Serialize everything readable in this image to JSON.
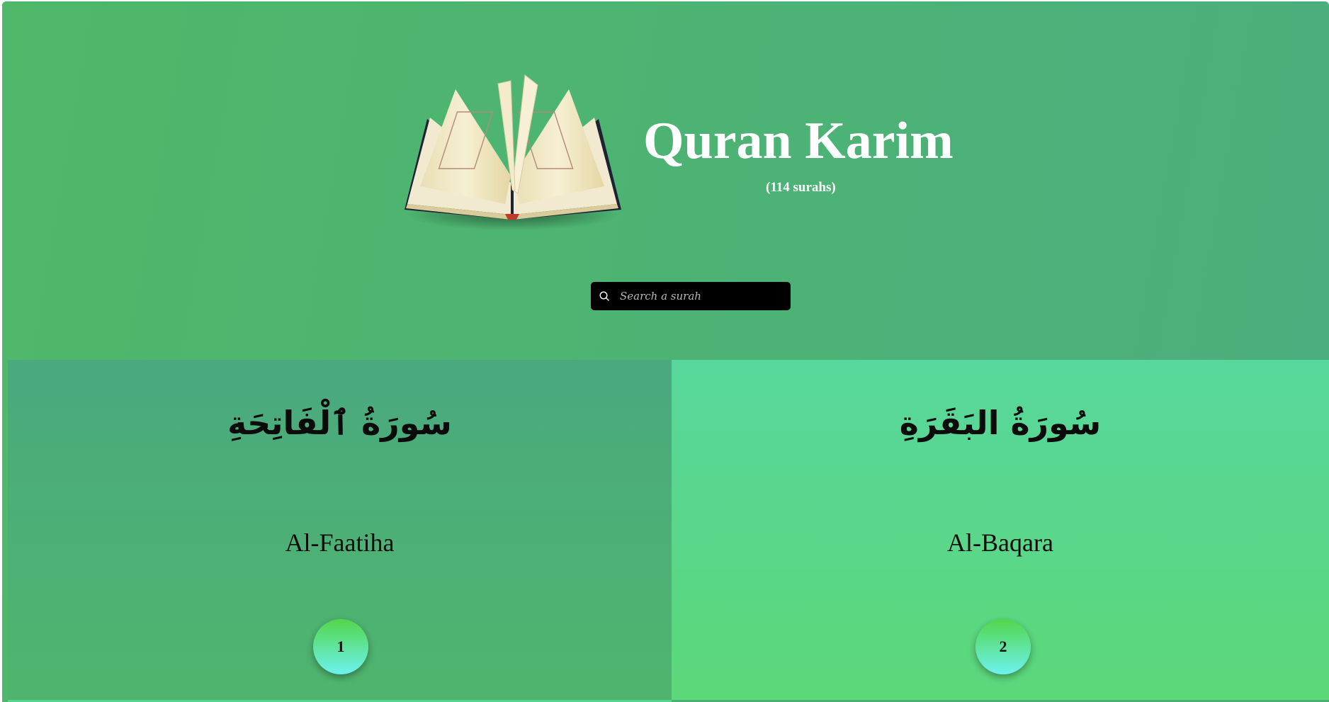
{
  "header": {
    "title": "Quran Karim",
    "subtitle": "(114 surahs)",
    "logo": "open-quran-book-image"
  },
  "search": {
    "placeholder": "Search a surah",
    "value": "",
    "icon": "search-icon"
  },
  "surahs": [
    {
      "arabic": "سُورَةُ ٱلْفَاتِحَةِ",
      "name": "Al-Faatiha",
      "number": "1"
    },
    {
      "arabic": "سُورَةُ البَقَرَةِ",
      "name": "Al-Baqara",
      "number": "2"
    }
  ],
  "colors": {
    "background_green": "#50b96a",
    "card_dark": "#4aa97f",
    "card_light": "#57d79c",
    "search_bg": "#000000",
    "badge_top": "#52d64a",
    "badge_bottom": "#6df2f0"
  }
}
